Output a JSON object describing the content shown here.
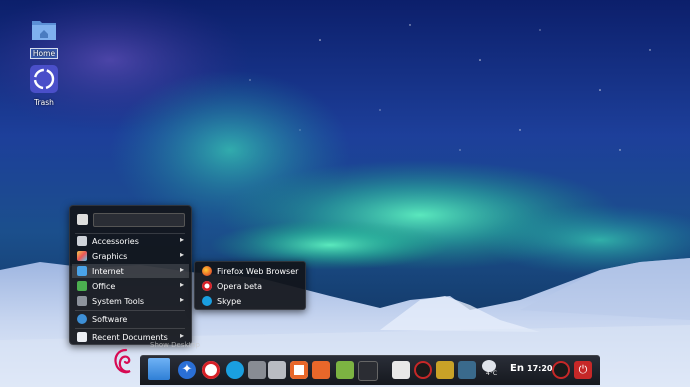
{
  "desktop": {
    "icons": [
      {
        "label": "Home",
        "icon": "home-folder-icon"
      },
      {
        "label": "Trash",
        "icon": "trash-icon"
      }
    ]
  },
  "menu": {
    "search": {
      "value": "",
      "placeholder": ""
    },
    "categories": [
      {
        "label": "Accessories",
        "icon": "accessories-icon",
        "has_submenu": true
      },
      {
        "label": "Graphics",
        "icon": "graphics-icon",
        "has_submenu": true
      },
      {
        "label": "Internet",
        "icon": "internet-icon",
        "has_submenu": true,
        "active": true
      },
      {
        "label": "Office",
        "icon": "office-icon",
        "has_submenu": true
      },
      {
        "label": "System Tools",
        "icon": "system-tools-icon",
        "has_submenu": true
      }
    ],
    "software": {
      "label": "Software",
      "icon": "software-icon"
    },
    "recent": {
      "label": "Recent Documents",
      "icon": "recent-documents-icon",
      "has_submenu": true
    }
  },
  "submenu": {
    "items": [
      {
        "label": "Firefox Web Browser",
        "icon": "firefox-icon"
      },
      {
        "label": "Opera beta",
        "icon": "opera-icon"
      },
      {
        "label": "Skype",
        "icon": "skype-icon"
      }
    ]
  },
  "tooltip": "Show Desktop",
  "taskbar": {
    "language": "En",
    "clock": "17:20",
    "weather": "4°C"
  },
  "colors": {
    "menu_bg": "#12141a",
    "accent_orange": "#e8672a",
    "opera_red": "#d61f26",
    "skype_blue": "#1a9fe0",
    "power_red": "#c62828"
  }
}
